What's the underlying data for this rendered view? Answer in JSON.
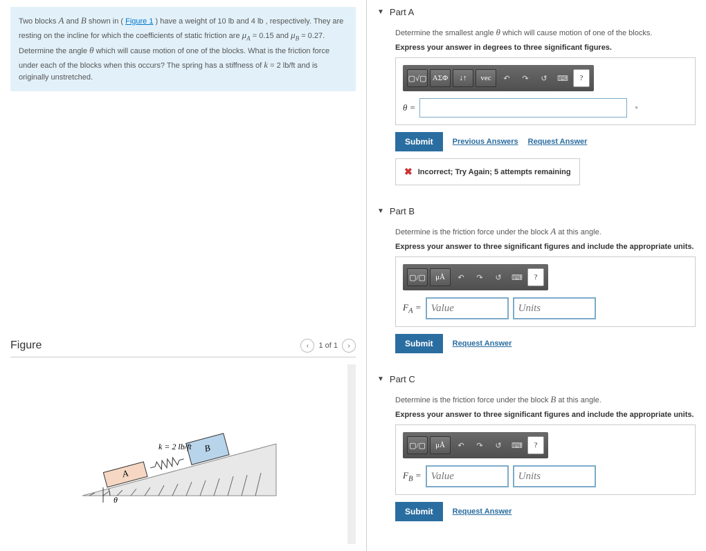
{
  "problem": {
    "text_1": "Two blocks ",
    "var_A": "A",
    "text_2": " and ",
    "var_B": "B",
    "text_3": " shown in (",
    "figure_link": "Figure 1",
    "text_4": ") have a weight of 10 ",
    "unit_lb": "lb",
    "text_5": " and 4 ",
    "text_6": ", respectively. They are resting on the incline for which the coefficients of static friction are ",
    "mu_A": "μA",
    "text_7": " = 0.15 and ",
    "mu_B": "μB",
    "text_8": " = 0.27. Determine the angle ",
    "theta": "θ",
    "text_9": " which will cause motion of one of the blocks. What is the friction force under each of the blocks when this occurs? The spring has a stiffness of ",
    "k_var": "k",
    "text_10": " = 2 ",
    "k_unit": "lb/ft",
    "text_11": " and is originally unstretched."
  },
  "figure_section": {
    "title": "Figure",
    "prev": "‹",
    "pager": "1 of 1",
    "next": "›",
    "k_label": "k = 2 lb/ft",
    "block_A": "A",
    "block_B": "B",
    "angle": "θ"
  },
  "toolbar": {
    "templates": "▢√▢",
    "greek": "ΑΣΦ",
    "subscript": "↓↑",
    "vec": "vec",
    "undo": "↶",
    "redo": "↷",
    "reset": "↺",
    "keyboard": "⌨",
    "help": "?",
    "frac": "▢/▢",
    "units_btn": "μÅ"
  },
  "partA": {
    "header": "Part A",
    "prompt_line1_a": "Determine the smallest angle ",
    "prompt_line1_b": " which will cause motion of one of the blocks.",
    "prompt_line2": "Express your answer in degrees to three significant figures.",
    "var_label": "θ =",
    "unit": "∘",
    "submit": "Submit",
    "prev_answers": "Previous Answers",
    "request": "Request Answer",
    "feedback": "Incorrect; Try Again; 5 attempts remaining"
  },
  "partB": {
    "header": "Part B",
    "prompt_line1_a": "Determine is the friction force under the block ",
    "prompt_line1_b": " at this angle.",
    "prompt_line2": "Express your answer to three significant figures and include the appropriate units.",
    "var_label": "FA =",
    "value_ph": "Value",
    "units_ph": "Units",
    "submit": "Submit",
    "request": "Request Answer"
  },
  "partC": {
    "header": "Part C",
    "prompt_line1_a": "Determine is the friction force under the block ",
    "prompt_line1_b": " at this angle.",
    "prompt_line2": "Express your answer to three significant figures and include the appropriate units.",
    "var_label": "FB =",
    "value_ph": "Value",
    "units_ph": "Units",
    "submit": "Submit",
    "request": "Request Answer"
  }
}
